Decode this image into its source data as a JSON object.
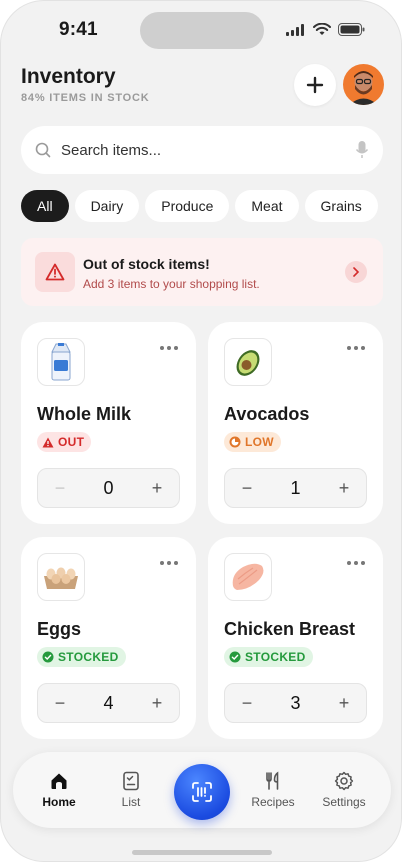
{
  "status_bar": {
    "time": "9:41"
  },
  "header": {
    "title": "Inventory",
    "subtitle": "84% ITEMS IN STOCK"
  },
  "search": {
    "placeholder": "Search items..."
  },
  "filters": [
    {
      "label": "All",
      "active": true
    },
    {
      "label": "Dairy",
      "active": false
    },
    {
      "label": "Produce",
      "active": false
    },
    {
      "label": "Meat",
      "active": false
    },
    {
      "label": "Grains",
      "active": false
    }
  ],
  "alert": {
    "title": "Out of stock items!",
    "message": "Add 3 items to your shopping list."
  },
  "items": [
    {
      "name": "Whole Milk",
      "status": "OUT",
      "quantity": "0",
      "icon": "milk-carton-icon"
    },
    {
      "name": "Avocados",
      "status": "LOW",
      "quantity": "1",
      "icon": "avocado-icon"
    },
    {
      "name": "Eggs",
      "status": "STOCKED",
      "quantity": "4",
      "icon": "egg-carton-icon"
    },
    {
      "name": "Chicken Breast",
      "status": "STOCKED",
      "quantity": "3",
      "icon": "chicken-breast-icon"
    }
  ],
  "tabs": [
    {
      "label": "Home",
      "icon": "home-icon",
      "active": true
    },
    {
      "label": "List",
      "icon": "checklist-icon",
      "active": false
    },
    {
      "label": "Recipes",
      "icon": "utensils-icon",
      "active": false
    },
    {
      "label": "Settings",
      "icon": "gear-icon",
      "active": false
    }
  ],
  "colors": {
    "accent": "#1b4be0",
    "danger": "#d42b2b",
    "warning": "#e0762a",
    "success": "#259a3d"
  }
}
